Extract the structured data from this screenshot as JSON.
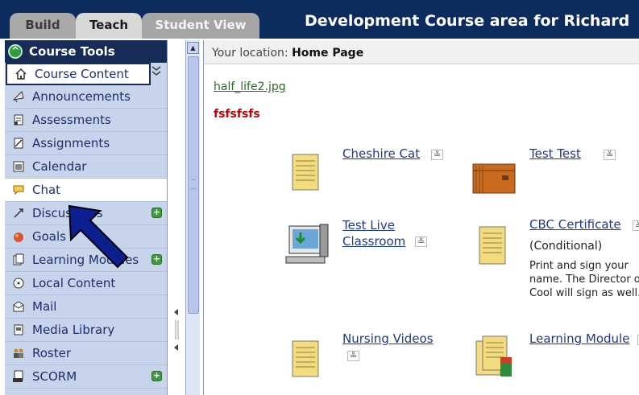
{
  "header": {
    "tabs": [
      {
        "label": "Build"
      },
      {
        "label": "Teach"
      },
      {
        "label": "Student View"
      }
    ],
    "course_title": "Development Course area for Richard"
  },
  "sidebar": {
    "title": "Course Tools",
    "items": [
      {
        "label": "Course Content",
        "icon": "home-icon"
      },
      {
        "label": "Announcements",
        "icon": "megaphone-icon"
      },
      {
        "label": "Assessments",
        "icon": "assessment-icon"
      },
      {
        "label": "Assignments",
        "icon": "assignment-icon"
      },
      {
        "label": "Calendar",
        "icon": "calendar-icon"
      },
      {
        "label": "Chat",
        "icon": "chat-icon"
      },
      {
        "label": "Discussions",
        "icon": "discussion-icon"
      },
      {
        "label": "Goals",
        "icon": "goals-icon"
      },
      {
        "label": "Learning Modules",
        "icon": "module-icon"
      },
      {
        "label": "Local Content",
        "icon": "cd-icon"
      },
      {
        "label": "Mail",
        "icon": "mail-icon"
      },
      {
        "label": "Media Library",
        "icon": "media-library-icon"
      },
      {
        "label": "Roster",
        "icon": "roster-icon"
      },
      {
        "label": "SCORM",
        "icon": "scorm-icon"
      }
    ]
  },
  "location": {
    "label": "Your location:",
    "value": "Home Page"
  },
  "content": {
    "file_link": "half_life2.jpg",
    "heading": "fsfsfsfs",
    "items": [
      {
        "title": "Cheshire Cat",
        "icon": "document-icon"
      },
      {
        "title": "Test Test",
        "icon": "folder-icon"
      },
      {
        "title": "Test Live Classroom",
        "title_line1": "Test Live",
        "title_line2": "Classroom",
        "icon": "live-classroom-icon"
      },
      {
        "title": "CBC Certificate",
        "icon": "document-icon",
        "meta": "(Conditional)",
        "description": "Print and sign your name. The Director of Cool will sign as well."
      },
      {
        "title": "Nursing Videos",
        "icon": "document-icon"
      },
      {
        "title": "Learning Module",
        "icon": "learning-module-icon"
      }
    ]
  },
  "colors": {
    "header_bg": "#0d2c5e",
    "sidebar_bg": "#c8d3ec",
    "link_green": "#2b6a2b",
    "link_blue": "#1f3a85",
    "heading_red": "#c00000",
    "arrow_blue": "#0c1f8f"
  }
}
